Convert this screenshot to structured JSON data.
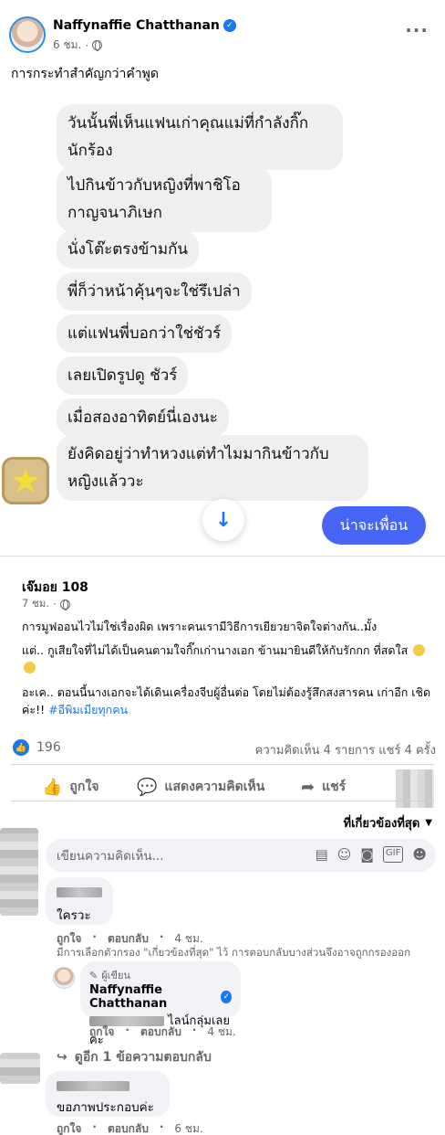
{
  "post": {
    "author": "Naffynaffie Chatthanan",
    "time": "6 ชม.",
    "caption": "การกระทำสำคัญกว่าคำพูด"
  },
  "chat": {
    "messages": [
      "วันนั้นพี่เห็นแฟนเก่าคุณแม่ที่กำลังกิ๊ก นักร้อง",
      "ไปกินข้าวกับหญิงที่พาชิโอ กาญจนาภิเษก",
      "นั่งโต๊ะตรงข้ามกัน",
      "พี่ก็ว่าหน้าคุ้นๆจะใช่รึเปล่า",
      "แต่แฟนพี่บอกว่าใช่ชัวร์",
      "เลยเปิดรูปดู ชัวร์",
      "เมื่อสองอาทิตย์นี่เองนะ",
      "ยังคิดอยู่ว่าทำหวงแต่ทำไมมากินข้าวกับ หญิงแล้ววะ"
    ],
    "reply": "น่าจะเพื่อน",
    "sticker_icon": "star-sticker",
    "scroll_icon": "arrow-down-icon"
  },
  "shared": {
    "author": "เจ๊มอย 108",
    "time": "7 ชม.",
    "p1": "การมูฟออนไวไม่ใช่เรื่องผิด เพราะคนเรามีวิธีการเยียวยาจิตใจต่างกัน..มั้ง",
    "p2": "แต่.. กูเสียใจที่ไม่ได้เป็นคนตามใจกิ๊กเก่านางเอก ข้านมายินดีให้กับรักกก ที่สดใส",
    "p3": "อะเค.. ตอนนี้นางเอกจะได้เดินเครื่องจีบผู้อื่นต่อ โดยไม่ต้องรู้สึกสงสารคน เก่าอีก เชิดค่ะ!!",
    "hashtag": "#อีพิมเมียทุกคน"
  },
  "stats": {
    "likes": "196",
    "comments_shares": "ความคิดเห็น 4 รายการ  แชร์ 4 ครั้ง"
  },
  "actions": {
    "like": "ถูกใจ",
    "comment": "แสดงความคิดเห็น",
    "share": "แชร์"
  },
  "sort_label": "ที่เกี่ยวข้องที่สุด",
  "composer": {
    "placeholder": "เขียนความคิดเห็น..."
  },
  "comments": [
    {
      "text": "ใครวะ",
      "like": "ถูกใจ",
      "reply": "ตอบกลับ",
      "time": "4 ชม."
    },
    {
      "text": "ขอภาพประกอบค่ะ",
      "like": "ถูกใจ",
      "reply": "ตอบกลับ",
      "time": "6 ชม."
    }
  ],
  "filter_note": "มีการเลือกตัวกรอง \"เกี่ยวข้องที่สุด\" ไว้ การตอบกลับบางส่วนจึงอาจถูกกรองออก",
  "author_reply": {
    "badge": "ผู้เขียน",
    "name": "Naffynaffie Chatthanan",
    "text": "ไลน์กลุ่มเลยคะ",
    "like": "ถูกใจ",
    "reply": "ตอบกลับ",
    "time": "4 ชม."
  },
  "more_replies": "ดูอีก 1 ข้อความตอบกลับ"
}
